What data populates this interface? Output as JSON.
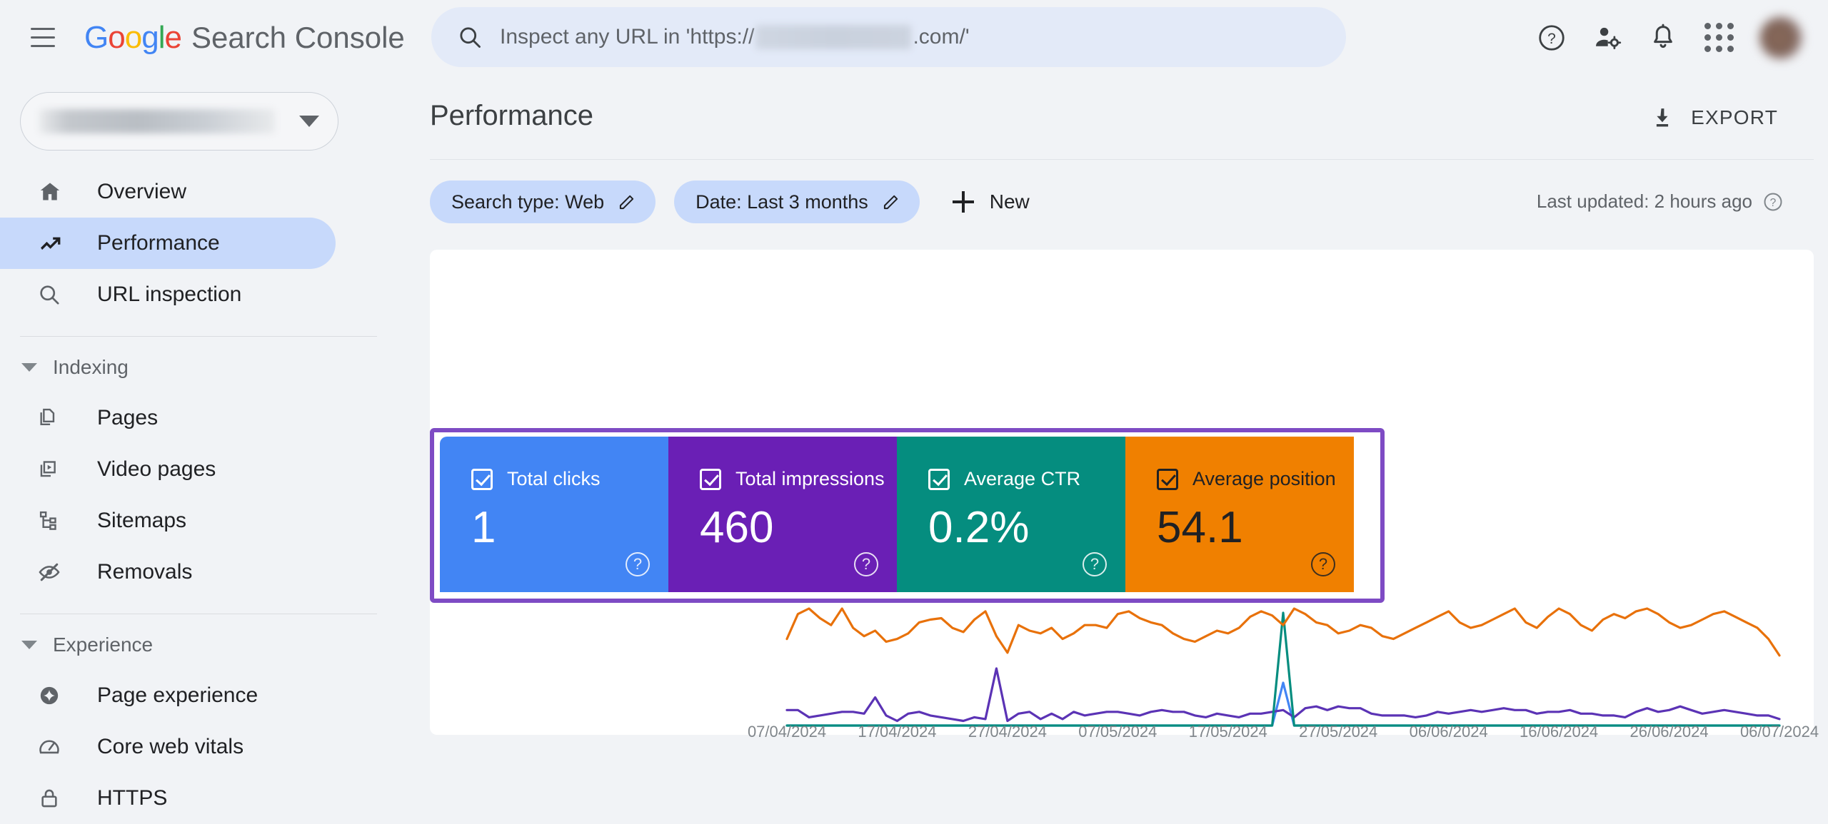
{
  "topbar": {
    "menu_icon": "hamburger-menu-icon",
    "brand": {
      "google": "Google",
      "product": "Search Console"
    },
    "search": {
      "icon": "search-icon",
      "placeholder_prefix": "Inspect any URL in 'https://",
      "placeholder_suffix": ".com/'",
      "value": ""
    },
    "icons": [
      {
        "name": "help-icon",
        "label": "Help"
      },
      {
        "name": "user-settings-icon",
        "label": "Users and permissions"
      },
      {
        "name": "notifications-bell-icon",
        "label": "Notifications"
      },
      {
        "name": "google-apps-grid-icon",
        "label": "Google apps"
      },
      {
        "name": "avatar",
        "label": "Google Account"
      }
    ]
  },
  "sidebar": {
    "property_selector": {
      "label": "",
      "caret": "chevron-down-icon"
    },
    "items": [
      {
        "label": "Overview",
        "icon": "home-icon",
        "active": false
      },
      {
        "label": "Performance",
        "icon": "trending-up-icon",
        "active": true
      },
      {
        "label": "URL inspection",
        "icon": "search-icon",
        "active": false
      }
    ],
    "groups": [
      {
        "title": "Indexing",
        "items": [
          {
            "label": "Pages",
            "icon": "pages-copy-icon"
          },
          {
            "label": "Video pages",
            "icon": "video-pages-icon"
          },
          {
            "label": "Sitemaps",
            "icon": "sitemap-tree-icon"
          },
          {
            "label": "Removals",
            "icon": "eye-off-icon"
          }
        ]
      },
      {
        "title": "Experience",
        "items": [
          {
            "label": "Page experience",
            "icon": "page-experience-star-icon"
          },
          {
            "label": "Core web vitals",
            "icon": "speedometer-icon"
          },
          {
            "label": "HTTPS",
            "icon": "lock-icon"
          }
        ]
      }
    ]
  },
  "main": {
    "page_title": "Performance",
    "export": {
      "label": "EXPORT",
      "icon": "download-icon"
    },
    "filters": [
      {
        "label": "Search type: Web",
        "edit_icon": "pencil-icon"
      },
      {
        "label": "Date: Last 3 months",
        "edit_icon": "pencil-icon"
      }
    ],
    "new_filter": {
      "label": "New",
      "icon": "plus-icon"
    },
    "last_updated": {
      "text": "Last updated: 2 hours ago",
      "icon": "help-icon"
    },
    "metric_tiles": [
      {
        "label": "Total clicks",
        "value": "1",
        "checked": true,
        "color": "#4285F4",
        "text_color": "#ffffff",
        "help_icon": "help-icon"
      },
      {
        "label": "Total impressions",
        "value": "460",
        "checked": true,
        "color": "#6A1FB5",
        "text_color": "#ffffff",
        "help_icon": "help-icon"
      },
      {
        "label": "Average CTR",
        "value": "0.2%",
        "checked": true,
        "color": "#058D7F",
        "text_color": "#ffffff",
        "help_icon": "help-icon"
      },
      {
        "label": "Average position",
        "value": "54.1",
        "checked": true,
        "color": "#F08000",
        "text_color": "#202124",
        "help_icon": "help-icon"
      }
    ],
    "highlight_border_color": "#7e4bc4"
  },
  "chart_data": {
    "type": "line",
    "title": "",
    "xlabel": "",
    "ylabel": "",
    "grid": false,
    "legend": "none",
    "x_tick_labels": [
      "07/04/2024",
      "17/04/2024",
      "27/04/2024",
      "07/05/2024",
      "17/05/2024",
      "27/05/2024",
      "06/06/2024",
      "16/06/2024",
      "26/06/2024",
      "06/07/2024"
    ],
    "x_range": [
      "07/04/2024",
      "06/07/2024"
    ],
    "n_points": 91,
    "series": [
      {
        "name": "Total clicks",
        "color": "#4285F4",
        "values": [
          0,
          0,
          0,
          0,
          0,
          0,
          0,
          0,
          0,
          0,
          0,
          0,
          0,
          0,
          0,
          0,
          0,
          0,
          0,
          0,
          0,
          0,
          0,
          0,
          0,
          0,
          0,
          0,
          0,
          0,
          0,
          0,
          0,
          0,
          0,
          0,
          0,
          0,
          0,
          0,
          0,
          0,
          0,
          0,
          0,
          1,
          0,
          0,
          0,
          0,
          0,
          0,
          0,
          0,
          0,
          0,
          0,
          0,
          0,
          0,
          0,
          0,
          0,
          0,
          0,
          0,
          0,
          0,
          0,
          0,
          0,
          0,
          0,
          0,
          0,
          0,
          0,
          0,
          0,
          0,
          0,
          0,
          0,
          0,
          0,
          0,
          0,
          0,
          0,
          0,
          0
        ]
      },
      {
        "name": "Total impressions",
        "color": "#5B33B5",
        "values": [
          7,
          7,
          3,
          4,
          5,
          6,
          6,
          5,
          14,
          4,
          1,
          5,
          6,
          4,
          3,
          2,
          1,
          3,
          2,
          30,
          1,
          5,
          6,
          2,
          5,
          2,
          6,
          4,
          5,
          6,
          6,
          5,
          4,
          6,
          7,
          6,
          6,
          4,
          3,
          5,
          4,
          3,
          5,
          5,
          6,
          7,
          3,
          8,
          9,
          7,
          9,
          8,
          8,
          5,
          4,
          4,
          4,
          3,
          4,
          6,
          5,
          6,
          7,
          6,
          7,
          8,
          7,
          7,
          5,
          6,
          6,
          7,
          5,
          5,
          4,
          4,
          3,
          6,
          8,
          6,
          7,
          9,
          7,
          5,
          6,
          7,
          6,
          5,
          4,
          4,
          2
        ]
      },
      {
        "name": "Average CTR",
        "color": "#058D7F",
        "values": [
          0,
          0,
          0,
          0,
          0,
          0,
          0,
          0,
          0,
          0,
          0,
          0,
          0,
          0,
          0,
          0,
          0,
          0,
          0,
          0,
          0,
          0,
          0,
          0,
          0,
          0,
          0,
          0,
          0,
          0,
          0,
          0,
          0,
          0,
          0,
          0,
          0,
          0,
          0,
          0,
          0,
          0,
          0,
          0,
          0,
          16.7,
          0,
          0,
          0,
          0,
          0,
          0,
          0,
          0,
          0,
          0,
          0,
          0,
          0,
          0,
          0,
          0,
          0,
          0,
          0,
          0,
          0,
          0,
          0,
          0,
          0,
          0,
          0,
          0,
          0,
          0,
          0,
          0,
          0,
          0,
          0,
          0,
          0,
          0,
          0,
          0,
          0,
          0,
          0,
          0,
          0
        ]
      },
      {
        "name": "Average position",
        "color": "#E8710A",
        "values": [
          40,
          58,
          62,
          55,
          50,
          62,
          48,
          42,
          46,
          38,
          40,
          44,
          52,
          54,
          55,
          48,
          45,
          54,
          60,
          42,
          30,
          50,
          46,
          44,
          48,
          40,
          44,
          50,
          50,
          48,
          58,
          60,
          55,
          52,
          50,
          44,
          40,
          38,
          42,
          46,
          44,
          48,
          56,
          60,
          57,
          50,
          62,
          58,
          52,
          50,
          44,
          46,
          50,
          48,
          42,
          40,
          44,
          48,
          52,
          56,
          60,
          52,
          48,
          50,
          54,
          58,
          62,
          52,
          48,
          56,
          62,
          58,
          50,
          46,
          54,
          58,
          55,
          60,
          62,
          58,
          52,
          48,
          50,
          54,
          58,
          60,
          56,
          52,
          48,
          40,
          28
        ]
      }
    ]
  }
}
